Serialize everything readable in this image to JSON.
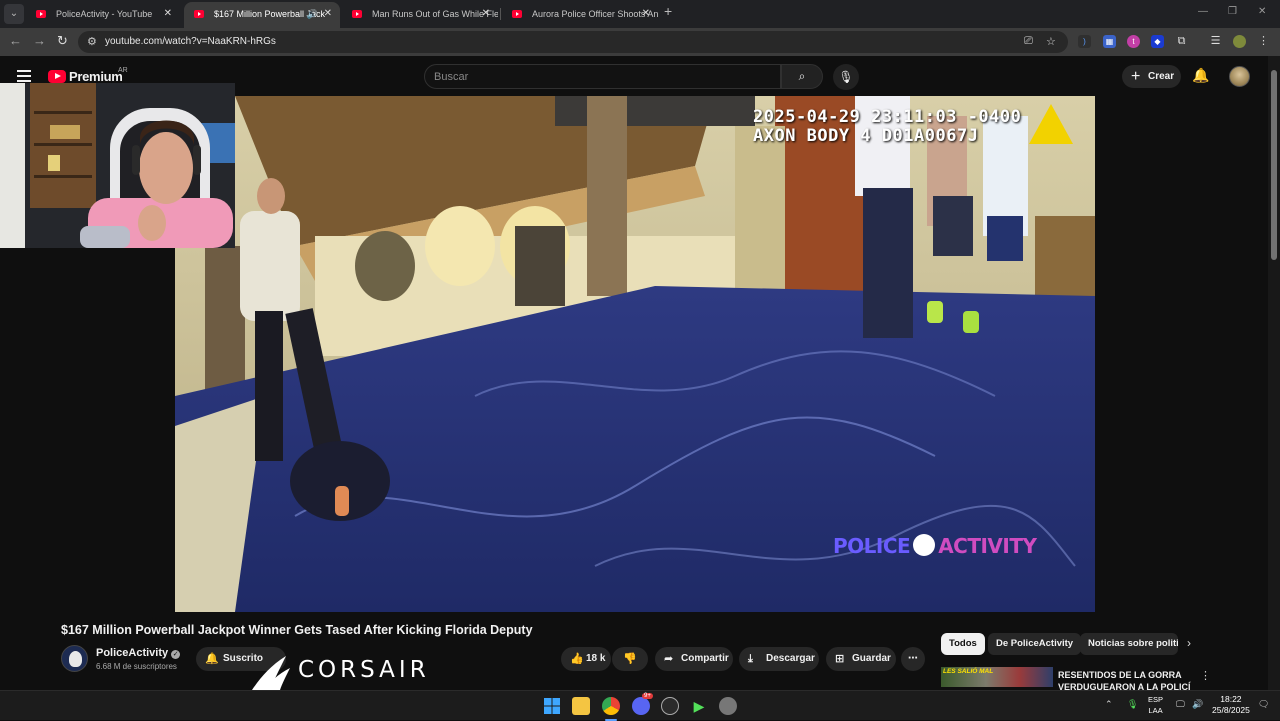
{
  "browser": {
    "tabs": [
      {
        "title": "PoliceActivity - YouTube",
        "active": false
      },
      {
        "title": "$167 Million Powerball Jack",
        "active": true
      },
      {
        "title": "Man Runs Out of Gas While Fle",
        "active": false
      },
      {
        "title": "Aurora Police Officer Shoots An",
        "active": false
      }
    ],
    "url": "youtube.com/watch?v=NaaKRN-hRGs"
  },
  "youtube": {
    "brand": "Premium",
    "country": "AR",
    "search_placeholder": "Buscar",
    "create_label": "Crear"
  },
  "video": {
    "overlay_line1": "2025-04-29 23:11:03 -0400",
    "overlay_line2": "AXON BODY 4 D01A0067J",
    "watermark_left": "POLICE",
    "watermark_right": "ACTIVITY",
    "title": "$167 Million Powerball Jackpot Winner Gets Tased After Kicking Florida Deputy"
  },
  "channel": {
    "name": "PoliceActivity",
    "subscribers": "6.68 M de suscriptores",
    "subscribed_label": "Suscrito"
  },
  "actions": {
    "likes": "18 k",
    "share": "Compartir",
    "download": "Descargar",
    "save": "Guardar"
  },
  "sidebar": {
    "chips": [
      "Todos",
      "De PoliceActivity",
      "Noticias sobre politi"
    ],
    "rec_thumb_text": "LES SALIÓ MAL",
    "rec_title": "RESENTIDOS DE LA GORRA VERDUGUEARON A LA POLICÍ"
  },
  "overlay": {
    "corsair": "CORSAIR"
  },
  "taskbar": {
    "lang_line1": "ESP",
    "lang_line2": "LAA",
    "time": "18:22",
    "date": "25/8/2025",
    "discord_badge": "9+"
  },
  "colors": {
    "yt_red": "#ff0033",
    "bg": "#0f0f0f",
    "watermark_blue": "#6a5cff",
    "watermark_pink": "#d04cc0"
  }
}
